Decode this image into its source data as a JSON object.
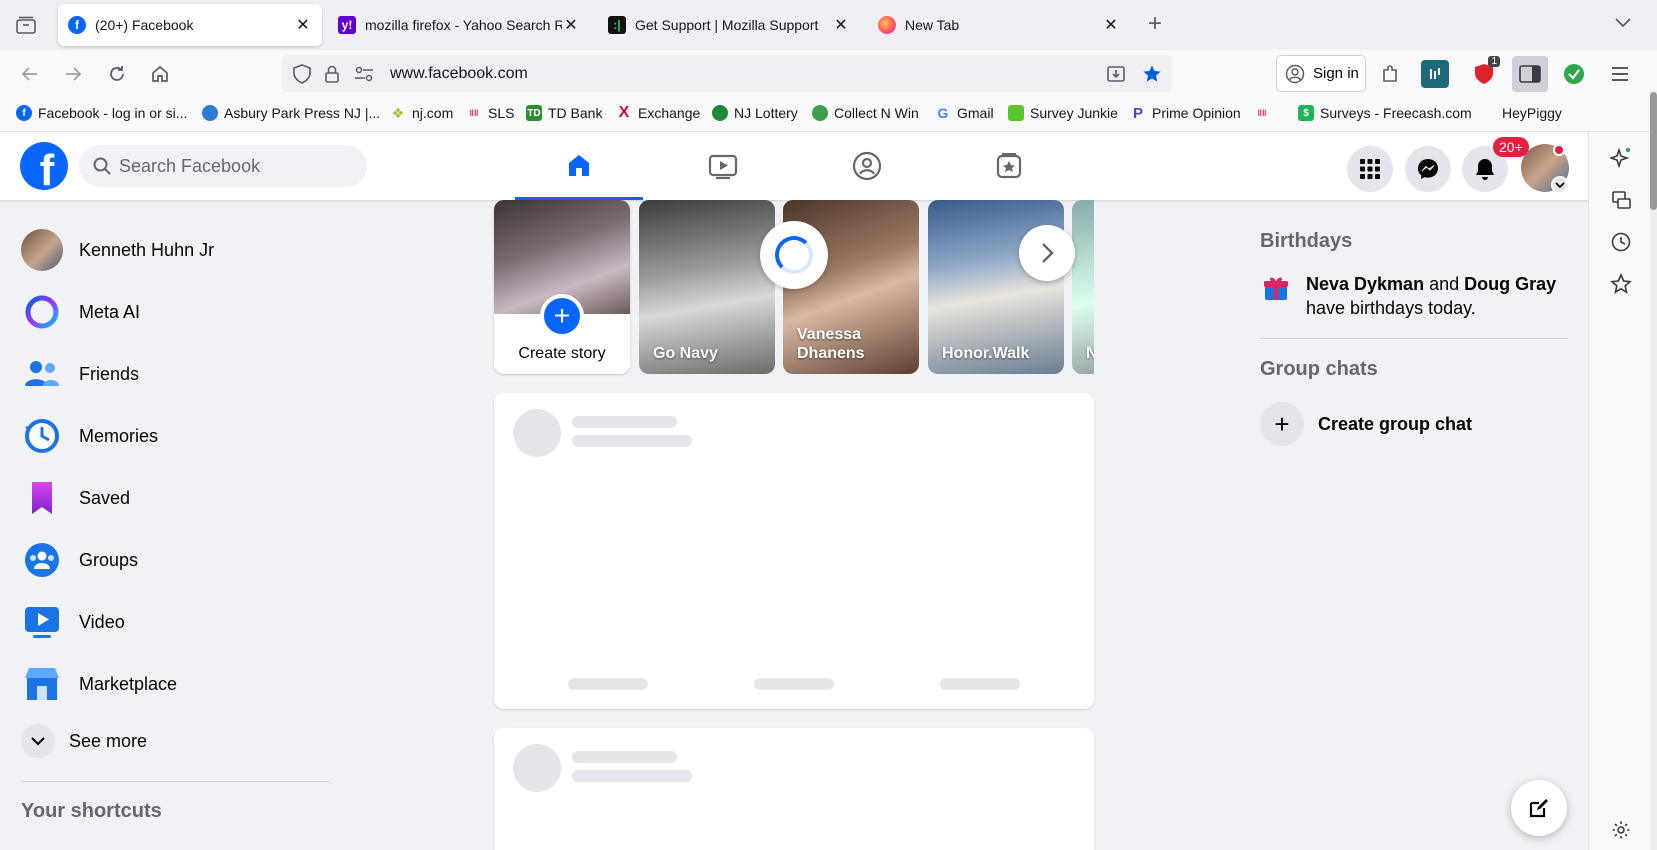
{
  "browser": {
    "tabs": [
      {
        "title": "(20+) Facebook",
        "active": true
      },
      {
        "title": "mozilla firefox - Yahoo Search Re",
        "active": false
      },
      {
        "title": "Get Support | Mozilla Support",
        "active": false
      },
      {
        "title": "New Tab",
        "active": false
      }
    ],
    "url": "www.facebook.com",
    "sign_in_label": "Sign in",
    "extension_badge": "1",
    "bookmarks": [
      "Facebook - log in or si...",
      "Asbury Park Press NJ |...",
      "nj.com",
      "SLS",
      "TD Bank",
      "Exchange",
      "NJ Lottery",
      "Collect N Win",
      "Gmail",
      "Survey Junkie",
      "Prime Opinion",
      "",
      "Surveys - Freecash.com",
      "HeyPiggy"
    ]
  },
  "header": {
    "search_placeholder": "Search Facebook",
    "notification_count": "20+"
  },
  "left_nav": {
    "items": [
      {
        "label": "Kenneth Huhn Jr",
        "icon": "profile-avatar"
      },
      {
        "label": "Meta AI",
        "icon": "meta-ai-icon"
      },
      {
        "label": "Friends",
        "icon": "friends-icon"
      },
      {
        "label": "Memories",
        "icon": "memories-icon"
      },
      {
        "label": "Saved",
        "icon": "saved-icon"
      },
      {
        "label": "Groups",
        "icon": "groups-icon"
      },
      {
        "label": "Video",
        "icon": "video-icon"
      },
      {
        "label": "Marketplace",
        "icon": "marketplace-icon"
      }
    ],
    "see_more": "See more",
    "shortcuts_title": "Your shortcuts"
  },
  "stories": {
    "create_label": "Create story",
    "items": [
      "Go Navy",
      "Vanessa Dhanens",
      "Honor.Walk",
      "N"
    ]
  },
  "right_col": {
    "birthdays_title": "Birthdays",
    "birthday_name1": "Neva Dykman",
    "birthday_and": "and",
    "birthday_name2": "Doug Gray",
    "birthday_suffix": "have birthdays today.",
    "group_chats_title": "Group chats",
    "create_group_chat": "Create group chat"
  },
  "colors": {
    "fb_blue": "#0866ff",
    "badge_red": "#e41e3f"
  }
}
